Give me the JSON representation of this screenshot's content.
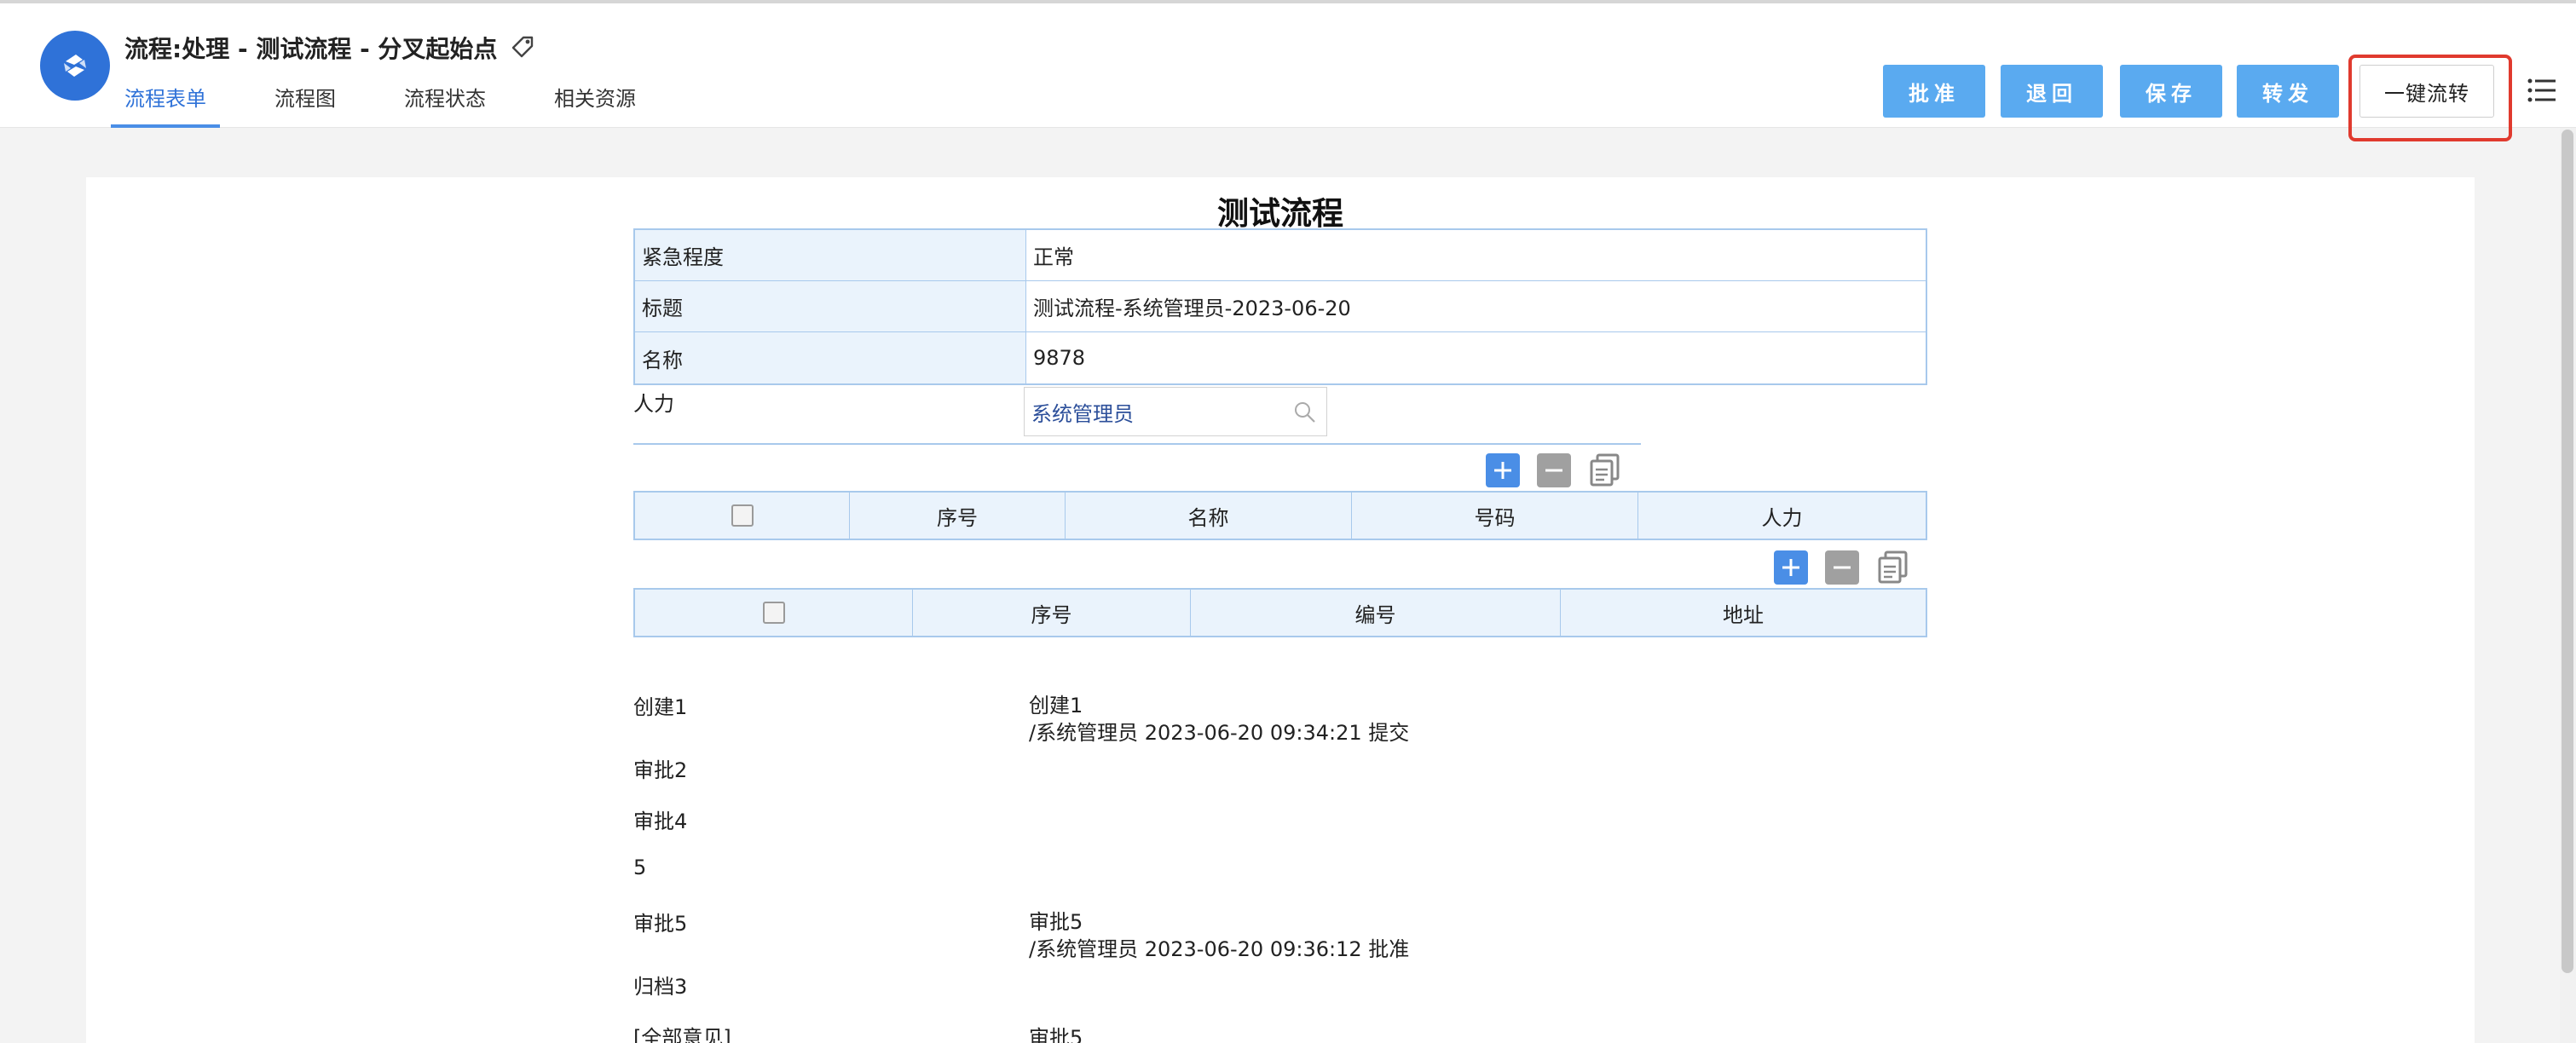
{
  "header": {
    "title": "流程:处理 - 测试流程 - 分叉起始点",
    "tabs": [
      {
        "label": "流程表单",
        "active": true
      },
      {
        "label": "流程图",
        "active": false
      },
      {
        "label": "流程状态",
        "active": false
      },
      {
        "label": "相关资源",
        "active": false
      }
    ],
    "actions": {
      "approve": "批准",
      "return": "退回",
      "save": "保存",
      "forward": "转发",
      "one_click": "一键流转"
    },
    "accent_color": "#2f72d8",
    "highlight_color": "#e03a2e"
  },
  "form": {
    "title": "测试流程",
    "fields": [
      {
        "label": "紧急程度",
        "value": "正常"
      },
      {
        "label": "标题",
        "value": "测试流程-系统管理员-2023-06-20"
      },
      {
        "label": "名称",
        "value": "9878"
      }
    ],
    "renli": {
      "label": "人力",
      "value": "系统管理员"
    },
    "table1": {
      "columns": [
        "",
        "序号",
        "名称",
        "号码",
        "人力"
      ]
    },
    "table2": {
      "columns": [
        "",
        "序号",
        "编号",
        "地址"
      ]
    }
  },
  "workflow": [
    {
      "label": "创建1",
      "comment_line1": "创建1",
      "comment_line2": "/系统管理员 2023-06-20 09:34:21 提交"
    },
    {
      "label": "审批2"
    },
    {
      "label": "审批4"
    },
    {
      "label": "5"
    },
    {
      "label": "审批5",
      "comment_line1": "审批5",
      "comment_line2": "/系统管理员 2023-06-20 09:36:12 批准"
    },
    {
      "label": "归档3"
    },
    {
      "label": "[全部意见]",
      "comment_line1": "审批5"
    }
  ]
}
